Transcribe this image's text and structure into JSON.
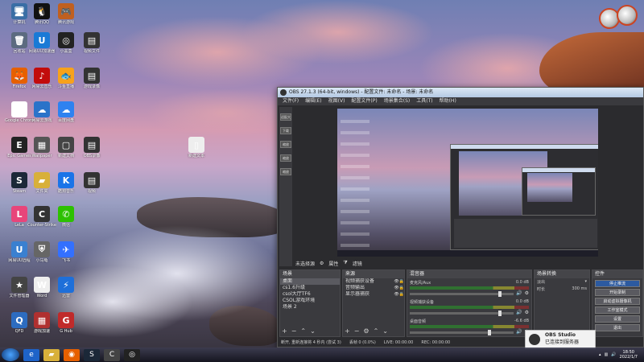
{
  "desktop": {
    "icons": [
      {
        "label": "计算机",
        "glyph": "🖥",
        "bg": "#3a6ea5"
      },
      {
        "label": "腾讯QQ",
        "glyph": "🐧",
        "bg": "#111"
      },
      {
        "label": "腾讯游戏",
        "glyph": "🎮",
        "bg": "#c06020"
      },
      {
        "label": "回收站",
        "glyph": "🗑",
        "bg": "#5c6b80"
      },
      {
        "label": "网易UU加速器",
        "glyph": "U",
        "bg": "#1a7ad6"
      },
      {
        "label": "小黑盒",
        "glyph": "◎",
        "bg": "#222"
      },
      {
        "label": "视频文件",
        "glyph": "▤",
        "bg": "#333"
      },
      {
        "label": "Firefox",
        "glyph": "🦊",
        "bg": "#e66000"
      },
      {
        "label": "网易云音乐",
        "glyph": "♪",
        "bg": "#c20c0c"
      },
      {
        "label": "斗鱼直播",
        "glyph": "🐟",
        "bg": "#f7a21b"
      },
      {
        "label": "游戏录像",
        "glyph": "▤",
        "bg": "#333"
      },
      {
        "label": "Google Chrome",
        "glyph": "◉",
        "bg": "#fff"
      },
      {
        "label": "网易云游戏",
        "glyph": "☁",
        "bg": "#2b73c9"
      },
      {
        "label": "百度网盘",
        "glyph": "☁",
        "bg": "#2e82f0"
      },
      {
        "label": "Epic Games",
        "glyph": "E",
        "bg": "#222"
      },
      {
        "label": "Wallpaper",
        "glyph": "▦",
        "bg": "#555"
      },
      {
        "label": "新建文档",
        "glyph": "▢",
        "bg": "#444"
      },
      {
        "label": "OBS录像",
        "glyph": "▤",
        "bg": "#333"
      },
      {
        "label": "新建文本",
        "glyph": "▯",
        "bg": "#eee"
      },
      {
        "label": "Steam",
        "glyph": "S",
        "bg": "#1b2838"
      },
      {
        "label": "文件夹",
        "glyph": "▰",
        "bg": "#d8b03a"
      },
      {
        "label": "酷狗音乐",
        "glyph": "K",
        "bg": "#1a74e8"
      },
      {
        "label": "视频",
        "glyph": "▤",
        "bg": "#333"
      },
      {
        "label": "LeLa",
        "glyph": "L",
        "bg": "#e8457a"
      },
      {
        "label": "Counter-Strike",
        "glyph": "C",
        "bg": "#333"
      },
      {
        "label": "微信",
        "glyph": "✆",
        "bg": "#2dc100"
      },
      {
        "label": "网易UU远程",
        "glyph": "U",
        "bg": "#3a80d0"
      },
      {
        "label": "小乌龟",
        "glyph": "⛨",
        "bg": "#666"
      },
      {
        "label": "飞书",
        "glyph": "✈",
        "bg": "#3370ff"
      },
      {
        "label": "文件管理器",
        "glyph": "★",
        "bg": "#444"
      },
      {
        "label": "Word",
        "glyph": "W",
        "bg": "#eee"
      },
      {
        "label": "迅雷",
        "glyph": "⚡",
        "bg": "#1e6fd9"
      },
      {
        "label": "QFD",
        "glyph": "Q",
        "bg": "#2d6cc0"
      },
      {
        "label": "游戏加速",
        "glyph": "▦",
        "bg": "#b03030"
      },
      {
        "label": "G Hub",
        "glyph": "G",
        "bg": "#c02a2a"
      }
    ]
  },
  "obs": {
    "title": "OBS 27.1.3 (64-bit, windows) - 配置文件: 未命名 - 场景: 未命名",
    "menu": [
      "文件(F)",
      "编辑(E)",
      "视图(V)",
      "配置文件(P)",
      "场景集合(S)",
      "工具(T)",
      "帮助(H)"
    ],
    "side_labels": [
      "适配大小",
      "下载",
      "缩放",
      "缩放",
      "缩放"
    ],
    "status_strip": {
      "label": "未选择源",
      "props": "属性",
      "filters": "滤镜"
    },
    "scenes": {
      "header": "场景",
      "items": [
        "桌面",
        "cs1.6升级",
        "csol大厅TF6",
        "CSOL游戏环境",
        "场景 2"
      ],
      "selected": 0
    },
    "sources": {
      "header": "来源",
      "items": [
        "视频捕获设备",
        "音频输出",
        "显示器捕获"
      ]
    },
    "mixer": {
      "header": "混音器",
      "channels": [
        {
          "name": "麦克风/Aux",
          "db": "0.0 dB",
          "level": 0.85
        },
        {
          "name": "视频捕获设备",
          "db": "0.0 dB",
          "level": 0.85
        },
        {
          "name": "桌面音频",
          "db": "-6.6 dB",
          "level": 0.75
        }
      ]
    },
    "transitions": {
      "header": "场景转换",
      "type": "淡出",
      "duration_label": "时长",
      "duration": "300 ms"
    },
    "controls": {
      "header": "控件",
      "buttons": [
        "停止推流",
        "开始录制",
        "启动虚拟摄像机",
        "工作室模式",
        "设置",
        "退出"
      ]
    },
    "bottom_status": {
      "left": "断开, 重新连接将 4 秒内 (尝试 3)",
      "dropped": "丢帧 0 (0.0%)",
      "live": "LIVE: 00:00:00",
      "rec": "REC: 00:00:00",
      "cpu": "CPU: 2.4%, 30.00 fps",
      "kbps": "kb/s: 0"
    }
  },
  "notification": {
    "title": "OBS Studio",
    "body": "已连接到服务器"
  },
  "taskbar": {
    "items": [
      {
        "name": "ie",
        "glyph": "e",
        "bg": "#1e63c8"
      },
      {
        "name": "explorer",
        "glyph": "▰",
        "bg": "#d8b03a"
      },
      {
        "name": "firefox",
        "glyph": "◉",
        "bg": "#e66000"
      },
      {
        "name": "steam",
        "glyph": "S",
        "bg": "#1b2838"
      },
      {
        "name": "cs",
        "glyph": "C",
        "bg": "#444"
      },
      {
        "name": "obs",
        "glyph": "◎",
        "bg": "#222"
      }
    ],
    "time": "18:50",
    "date": "2022/1/7"
  }
}
